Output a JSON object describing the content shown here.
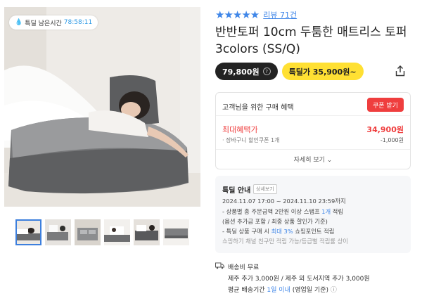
{
  "timer": {
    "label": "특딜 남은시간",
    "time": "78:58:11"
  },
  "rating": {
    "stars": "★★★★★",
    "review_link": "리뷰 71건"
  },
  "product": {
    "title_line1": "반반토퍼 10cm 두툼한 매트리스 토퍼",
    "title_line2": "3colors (SS/Q)"
  },
  "price": {
    "original": "79,800원",
    "question": "?",
    "deal": "특딜가 35,900원~"
  },
  "icons": {
    "share": "share-icon",
    "truck": "truck-icon",
    "info": "info-icon",
    "chevron": "chevron-down-icon",
    "drop": "drop-icon"
  },
  "benefit": {
    "heading": "고객님을 위한 구매 혜택",
    "coupon_button": "쿠폰 받기",
    "max_label": "최대혜택가",
    "max_value": "34,900원",
    "cart_label": "· 장바구니 할인쿠폰 1개",
    "cart_value": "-1,000원",
    "detail_link": "자세히 보기"
  },
  "deal_info": {
    "title": "특딜 안내",
    "detail": "상세보기",
    "period": "2024.11.07 17:00 ~ 2024.11.10 23:59까지",
    "line1_a": "- 상품별 총 주문금액 2만원 이상 스탬프 ",
    "line1_b": "1개",
    "line1_c": " 적립",
    "line2": "(옵션 추가금 포함 / 최종 상품 할인가 기준)",
    "line3_a": "- 특딜 상품 구매 시 ",
    "line3_b": "최대 3%",
    "line3_c": " 쇼핑포인트 적립",
    "line4": "쇼핑하기 채널 친구만 적립 가능/등급별 적립률 상이"
  },
  "shipping": {
    "fee": "배송비 무료",
    "jeju": "제주 추가 3,000원 / 제주 외 도서지역 추가 3,000원",
    "avg_a": "평균 배송기간 ",
    "avg_b": "1일 이내",
    "avg_c": " (영업일 기준)"
  },
  "colors": {
    "accent_blue": "#3f86e8",
    "deal_yellow": "#ffe033",
    "coupon_red": "#ef3e3e",
    "dark": "#222222"
  }
}
